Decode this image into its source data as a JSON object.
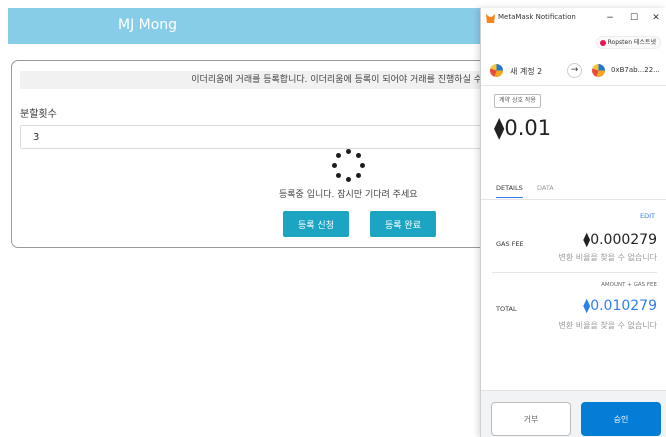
{
  "app": {
    "title": "MJ Mong",
    "notice": "이더리움에 거래를 등록합니다. 이더리움에 등록이 되어야 거래를 진행하실 수",
    "installments_label": "분할횟수",
    "installments_value": "3",
    "loading_text": "등록중 입니다. 잠시만 기다려 주세요",
    "request_button": "등록 신청",
    "complete_button": "등록 완료",
    "header_color": "#87cde8",
    "button_color": "#1ca5c2"
  },
  "metamask": {
    "window_title": "MetaMask Notification",
    "window_controls": {
      "minimize": "−",
      "maximize": "☐",
      "close": "✕"
    },
    "network": "Ropsten 테스트넷",
    "network_color": "#e91550",
    "from_account": "새 계정 2",
    "arrow": "→",
    "to_address": "0xB7ab...22...",
    "contract_tag": "계약 상호 작용",
    "eth_symbol": "⧫",
    "amount": "0.01",
    "tabs": {
      "details": "DETAILS",
      "data": "DATA"
    },
    "edit": "EDIT",
    "gas_fee_label": "GAS FEE",
    "gas_fee_value": "0.000279",
    "gas_fee_sub": "변환 비율을 찾을 수 없습니다",
    "amount_gas_label": "AMOUNT + GAS FEE",
    "total_label": "TOTAL",
    "total_value": "0.010279",
    "total_sub": "변환 비율을 찾을 수 없습니다",
    "reject_button": "거부",
    "approve_button": "승인",
    "accent_color": "#037dd6"
  }
}
